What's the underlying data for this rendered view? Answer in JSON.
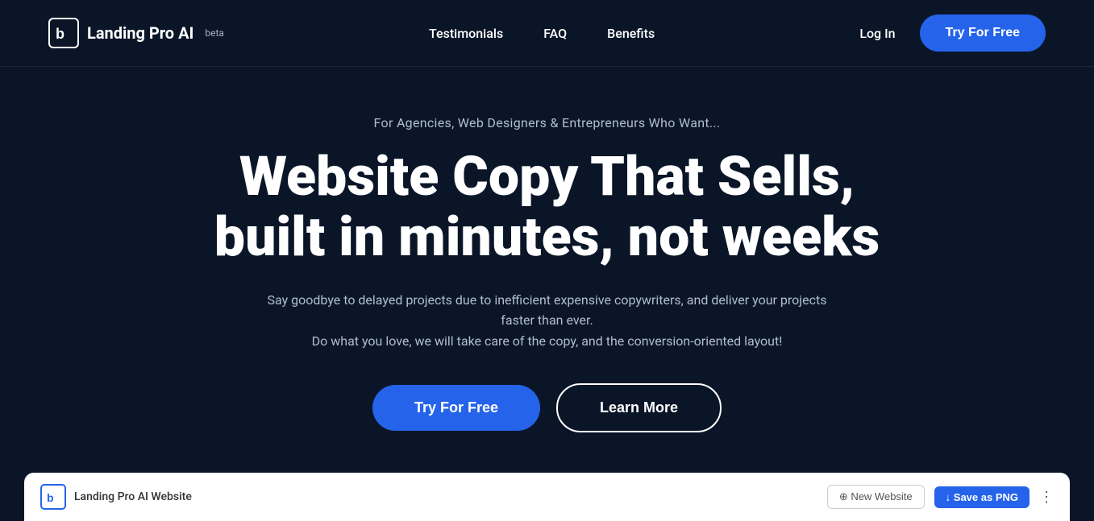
{
  "navbar": {
    "logo_icon_text": "b",
    "logo_text": "Landing Pro AI",
    "logo_beta": "beta",
    "nav_links": [
      {
        "label": "Testimonials",
        "href": "#"
      },
      {
        "label": "FAQ",
        "href": "#"
      },
      {
        "label": "Benefits",
        "href": "#"
      }
    ],
    "login_label": "Log In",
    "try_free_label": "Try For Free"
  },
  "hero": {
    "subtitle": "For Agencies, Web Designers & Entrepreneurs Who Want...",
    "title_line1": "Website Copy That Sells,",
    "title_line2": "built in minutes, not weeks",
    "description_line1": "Say goodbye to delayed projects due to inefficient expensive copywriters, and deliver your projects faster than ever.",
    "description_line2": "Do what you love, we will take care of the copy, and the conversion-oriented layout!",
    "try_free_label": "Try For Free",
    "learn_more_label": "Learn More"
  },
  "preview_bar": {
    "logo_text": "b",
    "title": "Landing Pro AI Website",
    "new_website_label": "⊕ New Website",
    "save_png_label": "↓ Save as PNG",
    "dots": "⋮"
  },
  "colors": {
    "bg": "#0a1628",
    "accent": "#2563eb",
    "white": "#ffffff",
    "text_muted": "#b0bdd0"
  }
}
